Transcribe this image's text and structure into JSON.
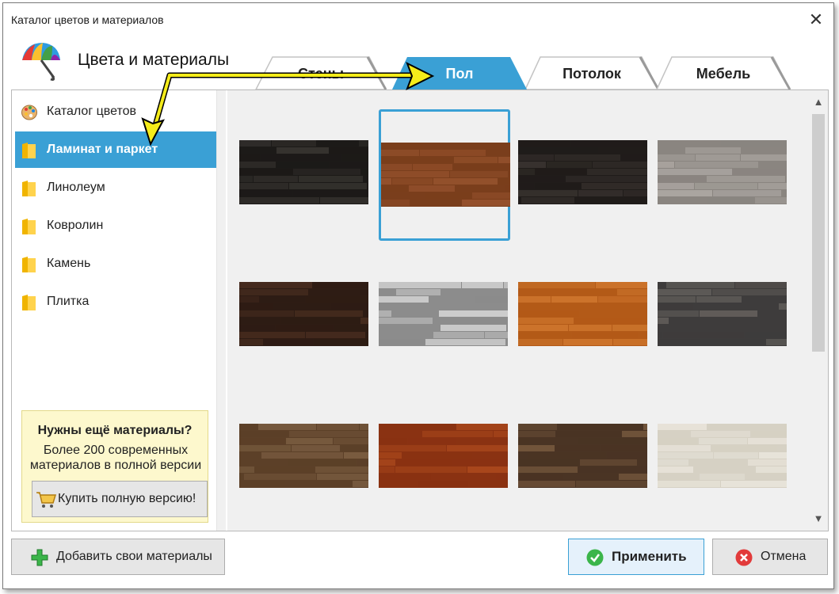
{
  "window": {
    "title": "Каталог цветов и материалов",
    "close_glyph": "✕"
  },
  "header": {
    "heading": "Цвета и материалы"
  },
  "tabs": [
    {
      "label": "Стены",
      "active": false
    },
    {
      "label": "Пол",
      "active": true
    },
    {
      "label": "Потолок",
      "active": false
    },
    {
      "label": "Мебель",
      "active": false
    }
  ],
  "sidebar": {
    "items": [
      {
        "label": "Каталог цветов",
        "icon": "palette-icon",
        "selected": false
      },
      {
        "label": "Ламинат и паркет",
        "icon": "folder-icon",
        "selected": true
      },
      {
        "label": "Линолеум",
        "icon": "folder-icon",
        "selected": false
      },
      {
        "label": "Ковролин",
        "icon": "folder-icon",
        "selected": false
      },
      {
        "label": "Камень",
        "icon": "folder-icon",
        "selected": false
      },
      {
        "label": "Плитка",
        "icon": "folder-icon",
        "selected": false
      }
    ]
  },
  "promo": {
    "title": "Нужны ещё материалы?",
    "text": "Более 200 современных материалов в полной версии",
    "buy_label": "Купить полную версию!",
    "buy_icon": "cart-icon"
  },
  "gallery": {
    "selected_index": 1,
    "textures": [
      {
        "base": "#1c1a18",
        "grain": "#3a3733"
      },
      {
        "base": "#7a3e1c",
        "grain": "#9a5530"
      },
      {
        "base": "#201c1a",
        "grain": "#3c3632"
      },
      {
        "base": "#8a8580",
        "grain": "#b0aba6"
      },
      {
        "base": "#2e1c14",
        "grain": "#4a2e20"
      },
      {
        "base": "#8c8c8c",
        "grain": "#d8d8d8"
      },
      {
        "base": "#b35a18",
        "grain": "#d27a30"
      },
      {
        "base": "#3e3c3c",
        "grain": "#66625e"
      },
      {
        "base": "#5c4028",
        "grain": "#7e6044"
      },
      {
        "base": "#8a3212",
        "grain": "#b04c1e"
      },
      {
        "base": "#4a3424",
        "grain": "#7a5c40"
      },
      {
        "base": "#d6d1c4",
        "grain": "#eae6dc"
      }
    ]
  },
  "footer": {
    "add_label": "Добавить свои материалы",
    "add_icon": "plus-icon",
    "apply_label": "Применить",
    "apply_icon": "check-icon",
    "cancel_label": "Отмена",
    "cancel_icon": "cancel-icon"
  },
  "colors": {
    "accent": "#3aa0d5",
    "annotation": "#f5ec1a"
  }
}
